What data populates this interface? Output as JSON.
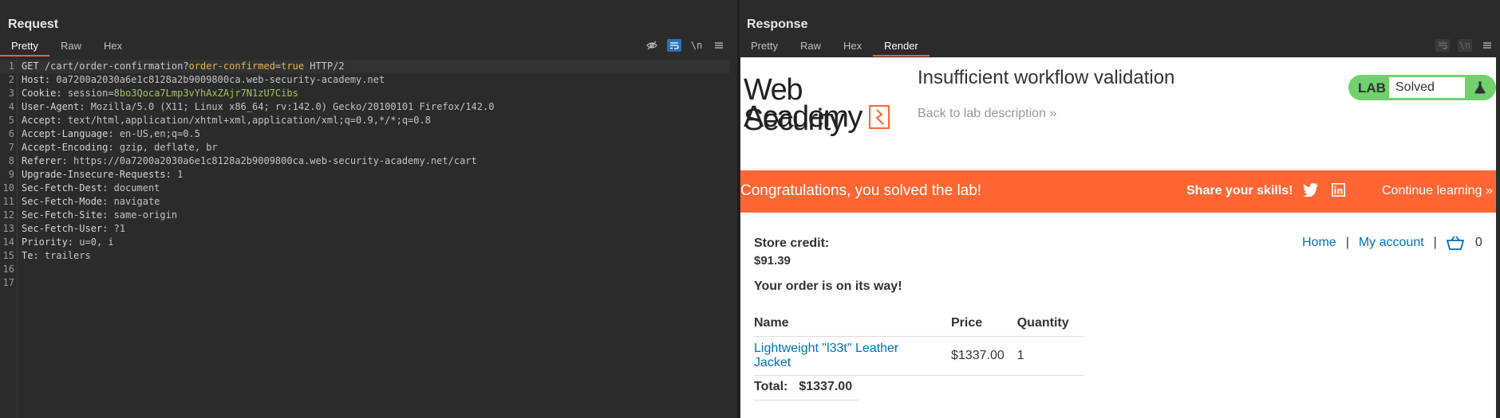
{
  "request": {
    "title": "Request",
    "tabs": [
      "Pretty",
      "Raw",
      "Hex"
    ],
    "lines": [
      {
        "n": "1",
        "method": "GET",
        "path": "/cart/order-confirmation?",
        "param_name": "order-confirmed",
        "param_eq": "=",
        "param_value": "true",
        "proto": " HTTP/2"
      },
      {
        "n": "2",
        "key": "Host:",
        "value": "0a7200a2030a6e1c8128a2b9009800ca.web-security-academy.net"
      },
      {
        "n": "3",
        "key": "Cookie:",
        "cookie_name": "session",
        "cookie_eq": "=",
        "cookie_value": "8bo3Qoca7Lmp3vYhAxZAjr7N1zU7Cibs"
      },
      {
        "n": "4",
        "key": "User-Agent:",
        "value": "Mozilla/5.0 (X11; Linux x86_64; rv:142.0) Gecko/20100101 Firefox/142.0"
      },
      {
        "n": "5",
        "key": "Accept:",
        "value": "text/html,application/xhtml+xml,application/xml;q=0.9,*/*;q=0.8"
      },
      {
        "n": "6",
        "key": "Accept-Language:",
        "value": "en-US,en;q=0.5"
      },
      {
        "n": "7",
        "key": "Accept-Encoding:",
        "value": "gzip, deflate, br"
      },
      {
        "n": "8",
        "key": "Referer:",
        "value": "https://0a7200a2030a6e1c8128a2b9009800ca.web-security-academy.net/cart"
      },
      {
        "n": "9",
        "key": "Upgrade-Insecure-Requests:",
        "value": "1"
      },
      {
        "n": "10",
        "key": "Sec-Fetch-Dest:",
        "value": "document"
      },
      {
        "n": "11",
        "key": "Sec-Fetch-Mode:",
        "value": "navigate"
      },
      {
        "n": "12",
        "key": "Sec-Fetch-Site:",
        "value": "same-origin"
      },
      {
        "n": "13",
        "key": "Sec-Fetch-User:",
        "value": "?1"
      },
      {
        "n": "14",
        "key": "Priority:",
        "value": "u=0, i"
      },
      {
        "n": "15",
        "key": "Te:",
        "value": "trailers"
      },
      {
        "n": "16"
      },
      {
        "n": "17"
      }
    ],
    "newline_toggle": "\\n"
  },
  "response": {
    "title": "Response",
    "tabs": [
      "Pretty",
      "Raw",
      "Hex",
      "Render"
    ],
    "newline_toggle": "\\n",
    "page": {
      "logo_line1": "Web Security",
      "logo_line2": "Academy",
      "lab_title": "Insufficient workflow validation",
      "back_link": "Back to lab description",
      "back_chevrons": "»",
      "lab_label": "LAB",
      "lab_status": "Solved",
      "banner_text": "Congratulations, you solved the lab!",
      "share_text": "Share your skills!",
      "continue_text": "Continue learning",
      "continue_chevrons": "»",
      "store_credit_label": "Store credit:",
      "store_credit_value": "$91.39",
      "order_message": "Your order is on its way!",
      "nav_home": "Home",
      "nav_sep": "|",
      "nav_account": "My account",
      "cart_count": "0",
      "table_headers": [
        "Name",
        "Price",
        "Quantity"
      ],
      "table_rows": [
        {
          "name": "Lightweight \"l33t\" Leather Jacket",
          "price": "$1337.00",
          "quantity": "1"
        }
      ],
      "total_label": "Total:",
      "total_value": "$1337.00"
    }
  },
  "colors": {
    "accent": "#e8643b",
    "banner": "#ff6633",
    "solved_green": "#70d16d",
    "link_blue": "#0071bc",
    "toggle_blue": "#2f6db5"
  }
}
